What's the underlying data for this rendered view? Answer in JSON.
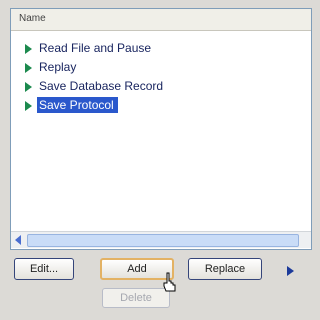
{
  "list": {
    "header": "Name",
    "items": [
      {
        "label": "Read File and Pause",
        "selected": false
      },
      {
        "label": "Replay",
        "selected": false
      },
      {
        "label": "Save Database Record",
        "selected": false
      },
      {
        "label": "Save Protocol",
        "selected": true
      }
    ]
  },
  "buttons": {
    "edit": "Edit...",
    "add": "Add",
    "replace": "Replace",
    "delete": "Delete"
  },
  "icons": {
    "item": "triangle-right-icon",
    "scroll_left": "arrow-left-icon",
    "more": "arrow-right-icon",
    "cursor": "hand-pointer-icon"
  },
  "colors": {
    "selection": "#2a58cc",
    "item_icon": "#1c8a4e",
    "focus_border": "#e3b264"
  }
}
